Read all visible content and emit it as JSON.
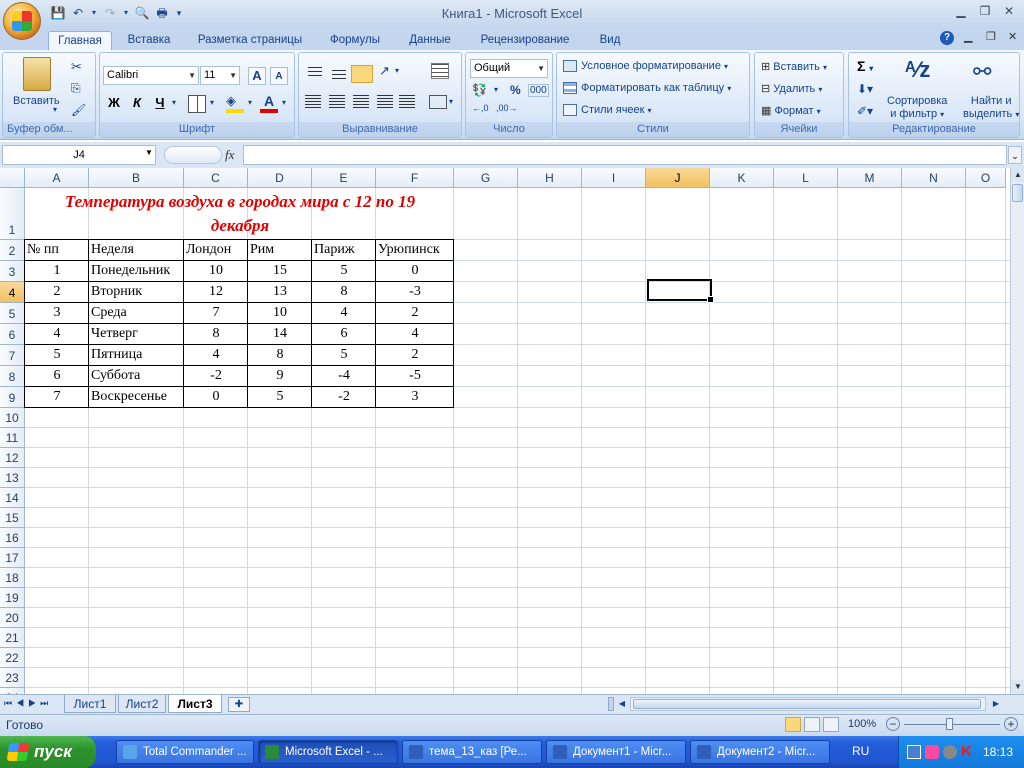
{
  "window": {
    "title": "Книга1  -  Microsoft Excel"
  },
  "ribbon_tabs": [
    "Главная",
    "Вставка",
    "Разметка страницы",
    "Формулы",
    "Данные",
    "Рецензирование",
    "Вид"
  ],
  "groups": {
    "clipboard": {
      "label": "Буфер обм...",
      "paste": "Вставить"
    },
    "font": {
      "label": "Шрифт",
      "name": "Calibri",
      "size": "11",
      "bold": "Ж",
      "italic": "К",
      "underline": "Ч"
    },
    "alignment": {
      "label": "Выравнивание"
    },
    "number": {
      "label": "Число",
      "format": "Общий",
      "percent": "%",
      "thousands": "000"
    },
    "styles": {
      "label": "Стили",
      "cond": "Условное форматирование",
      "table": "Форматировать как таблицу",
      "cellstyles": "Стили ячеек"
    },
    "cells": {
      "label": "Ячейки",
      "insert": "Вставить",
      "delete": "Удалить",
      "format": "Формат"
    },
    "editing": {
      "label": "Редактирование",
      "sigma": "Σ",
      "sort1": "Сортировка",
      "sort2": "и фильтр",
      "find1": "Найти и",
      "find2": "выделить"
    }
  },
  "formula_bar": {
    "name_box": "J4",
    "fx": "fx",
    "formula": ""
  },
  "columns": [
    "A",
    "B",
    "C",
    "D",
    "E",
    "F",
    "G",
    "H",
    "I",
    "J",
    "K",
    "L",
    "M",
    "N",
    "O"
  ],
  "rows": [
    "1",
    "2",
    "3",
    "4",
    "5",
    "6",
    "7",
    "8",
    "9",
    "10",
    "11",
    "12",
    "13",
    "14",
    "15",
    "16",
    "17",
    "18",
    "19",
    "20",
    "21",
    "22",
    "23",
    "24"
  ],
  "sheet": {
    "title_line1": "Температура воздуха в городах мира с 12 по 19",
    "title_line2": "декабря",
    "headers": [
      "№ пп",
      "Неделя",
      "Лондон",
      "Рим",
      "Париж",
      "Урюпинск"
    ],
    "data": [
      [
        "1",
        "Понедельник",
        "10",
        "15",
        "5",
        "0"
      ],
      [
        "2",
        "Вторник",
        "12",
        "13",
        "8",
        "-3"
      ],
      [
        "3",
        "Среда",
        "7",
        "10",
        "4",
        "2"
      ],
      [
        "4",
        "Четверг",
        "8",
        "14",
        "6",
        "4"
      ],
      [
        "5",
        "Пятница",
        "4",
        "8",
        "5",
        "2"
      ],
      [
        "6",
        "Суббота",
        "-2",
        "9",
        "-4",
        "-5"
      ],
      [
        "7",
        "Воскресенье",
        "0",
        "5",
        "-2",
        "3"
      ]
    ]
  },
  "sheet_tabs": [
    "Лист1",
    "Лист2",
    "Лист3"
  ],
  "status": {
    "ready": "Готово",
    "zoom": "100%"
  },
  "taskbar": {
    "start": "пуск",
    "tasks": [
      "Total Commander ...",
      "Microsoft Excel - ...",
      "тема_13_каз [Ре...",
      "Документ1 - Micr...",
      "Документ2 - Micr..."
    ],
    "lang": "RU",
    "clock": "18:13"
  }
}
